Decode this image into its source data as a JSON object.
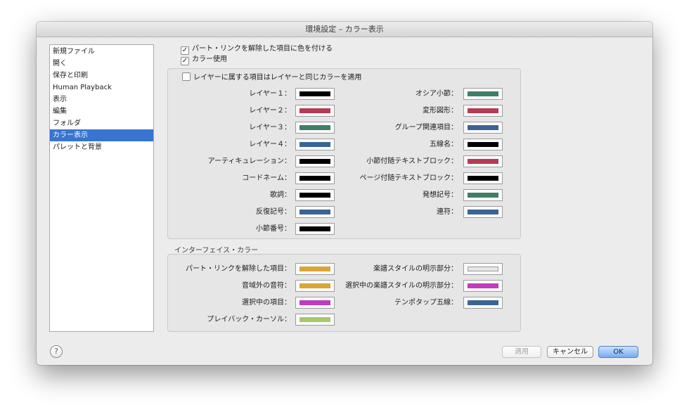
{
  "window": {
    "title": "環境設定 – カラー表示"
  },
  "sidebar": {
    "items": [
      {
        "label": "新規ファイル"
      },
      {
        "label": "開く"
      },
      {
        "label": "保存と印刷"
      },
      {
        "label": "Human Playback"
      },
      {
        "label": "表示"
      },
      {
        "label": "編集"
      },
      {
        "label": "フォルダ"
      },
      {
        "label": "カラー表示",
        "selected": true
      },
      {
        "label": "パレットと背景"
      }
    ]
  },
  "options": {
    "parts_link": {
      "label": "パート・リンクを解除した項目に色を付ける",
      "checked": true
    },
    "use_color": {
      "label": "カラー使用",
      "checked": true
    }
  },
  "colors_group": {
    "layer_checkbox": {
      "label": "レイヤーに属する項目はレイヤーと同じカラーを適用",
      "checked": false
    },
    "left": [
      {
        "label": "レイヤー１：",
        "color": "#000000"
      },
      {
        "label": "レイヤー２：",
        "color": "#b53a54"
      },
      {
        "label": "レイヤー３：",
        "color": "#3e7f65"
      },
      {
        "label": "レイヤー４：",
        "color": "#3b6495"
      },
      {
        "label": "アーティキュレーション：",
        "color": "#000000"
      },
      {
        "label": "コードネーム：",
        "color": "#000000"
      },
      {
        "label": "歌詞：",
        "color": "#000000"
      },
      {
        "label": "反復記号：",
        "color": "#3b6495"
      },
      {
        "label": "小節番号：",
        "color": "#000000"
      }
    ],
    "right": [
      {
        "label": "オシア小節：",
        "color": "#3e7f65"
      },
      {
        "label": "変形図形：",
        "color": "#b53a54"
      },
      {
        "label": "グループ関連項目：",
        "color": "#3b6495"
      },
      {
        "label": "五線名：",
        "color": "#000000"
      },
      {
        "label": "小節付随テキストブロック：",
        "color": "#b53a54"
      },
      {
        "label": "ページ付随テキストブロック：",
        "color": "#000000"
      },
      {
        "label": "発想記号：",
        "color": "#3e7f65"
      },
      {
        "label": "連符：",
        "color": "#3b6495"
      }
    ]
  },
  "interface_group": {
    "title": "インターフェイス・カラー",
    "left": [
      {
        "label": "パート・リンクを解除した項目：",
        "color": "#d9a537"
      },
      {
        "label": "音域外の音符：",
        "color": "#d9a537"
      },
      {
        "label": "選択中の項目：",
        "color": "#c13bbf"
      },
      {
        "label": "プレイバック・カーソル：",
        "color": "#a6c96a"
      }
    ],
    "right": [
      {
        "label": "楽譜スタイルの明示部分：",
        "color": "#e6e6e6"
      },
      {
        "label": "選択中の楽譜スタイルの明示部分：",
        "color": "#c13bbf"
      },
      {
        "label": "テンポタップ五線：",
        "color": "#3b6495"
      }
    ]
  },
  "footer": {
    "help": "?",
    "apply": "適用",
    "cancel": "キャンセル",
    "ok": "OK"
  }
}
